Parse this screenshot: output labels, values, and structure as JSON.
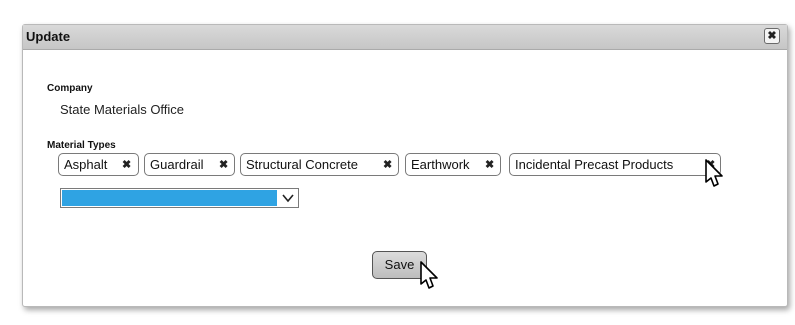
{
  "dialog": {
    "title": "Update",
    "close_label": "✖"
  },
  "company": {
    "label": "Company",
    "value": "State Materials Office"
  },
  "material_types": {
    "label": "Material Types",
    "chips": [
      {
        "label": "Asphalt",
        "remove_icon": "✖"
      },
      {
        "label": "Guardrail",
        "remove_icon": "✖"
      },
      {
        "label": "Structural Concrete",
        "remove_icon": "✖"
      },
      {
        "label": "Earthwork",
        "remove_icon": "✖"
      },
      {
        "label": "Incidental Precast Products",
        "remove_icon": "✖"
      }
    ],
    "select": {
      "selected_value": "",
      "highlight_color": "#2fa3e3"
    }
  },
  "actions": {
    "save_label": "Save"
  },
  "icons": [
    "close-icon",
    "remove-chip-icon",
    "chevron-down-icon",
    "mouse-pointer-icon"
  ]
}
